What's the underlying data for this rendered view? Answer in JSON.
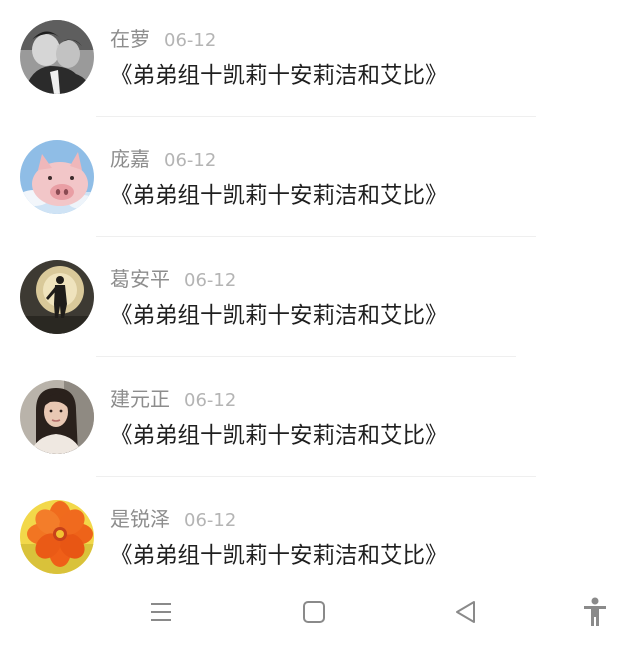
{
  "comments": [
    {
      "name": "在萝",
      "date": "06-12",
      "text": "《弟弟组十凯莉十安莉洁和艾比》",
      "avatar": "black-and-white-portrait"
    },
    {
      "name": "庞嘉",
      "date": "06-12",
      "text": "《弟弟组十凯莉十安莉洁和艾比》",
      "avatar": "pig-in-sky"
    },
    {
      "name": "葛安平",
      "date": "06-12",
      "text": "《弟弟组十凯莉十安莉洁和艾比》",
      "avatar": "silhouette-against-moon"
    },
    {
      "name": "建元正",
      "date": "06-12",
      "text": "《弟弟组十凯莉十安莉洁和艾比》",
      "avatar": "woman-portrait"
    },
    {
      "name": "是锐泽",
      "date": "06-12",
      "text": "《弟弟组十凯莉十安莉洁和艾比》",
      "avatar": "orange-flower"
    }
  ],
  "navbar": {
    "items": [
      "menu-icon",
      "home-icon",
      "back-icon",
      "accessibility-icon"
    ]
  },
  "colors": {
    "name": "#8d8d8d",
    "date": "#b4b4b4",
    "text": "#1f1f1f",
    "nav_icon": "#8a8a8a"
  }
}
